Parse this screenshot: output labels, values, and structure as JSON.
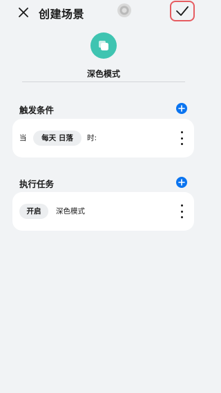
{
  "header": {
    "title": "创建场景",
    "close_icon": "close-icon",
    "confirm_icon": "check-icon",
    "confirm_highlight_color": "#e65b60"
  },
  "scene": {
    "icon": "scene-copy-icon",
    "icon_color": "#3fc4b1",
    "name": "深色模式"
  },
  "trigger": {
    "section_title": "触发条件",
    "prefix": "当",
    "time_value": "每天 日落",
    "suffix": "时:"
  },
  "action": {
    "section_title": "执行任务",
    "state": "开启",
    "target": "深色模式"
  },
  "accent_color": "#0a74f0"
}
